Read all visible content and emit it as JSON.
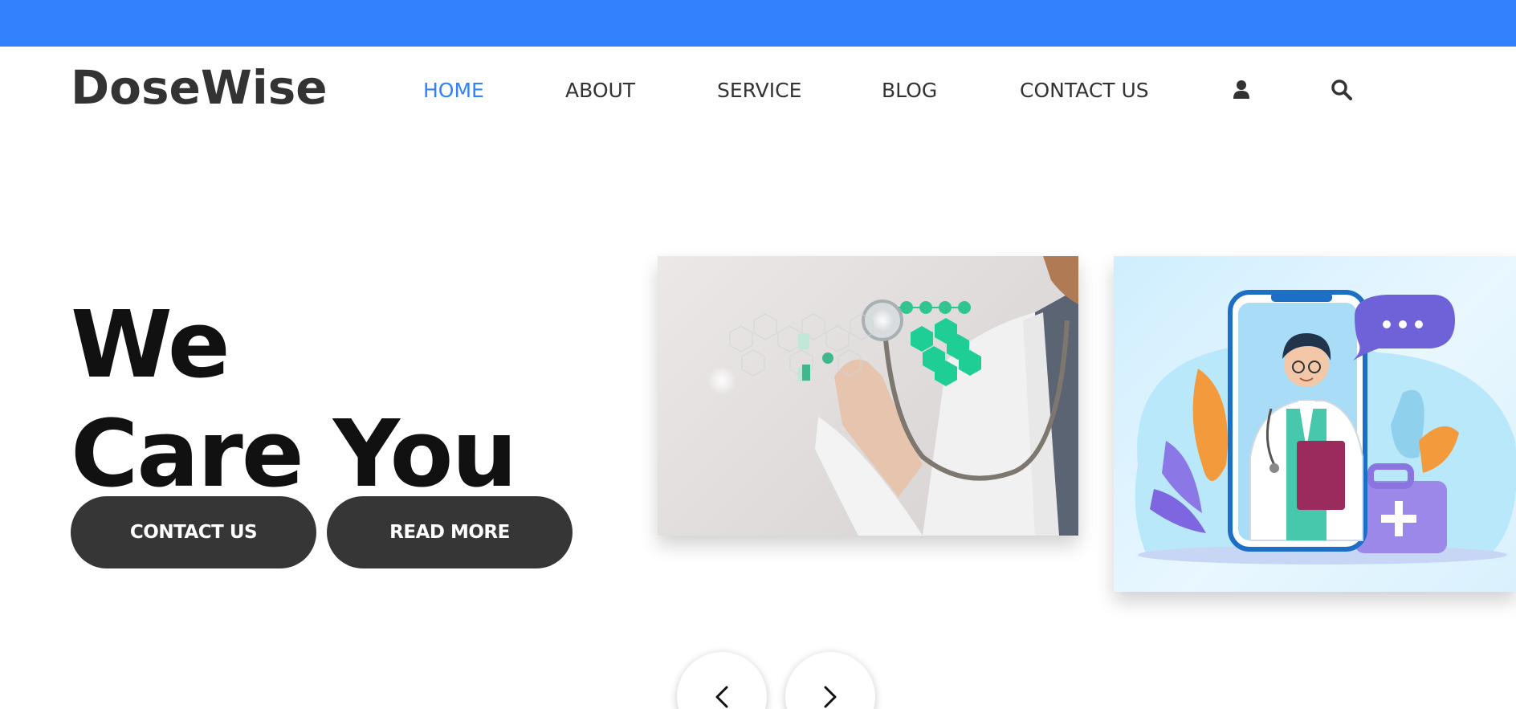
{
  "brand": {
    "name": "DoseWise",
    "accent_color": "#3282fd",
    "dark_button_color": "#363636"
  },
  "nav": {
    "items": [
      {
        "label": "HOME",
        "active": true
      },
      {
        "label": "ABOUT",
        "active": false
      },
      {
        "label": "SERVICE",
        "active": false
      },
      {
        "label": "BLOG",
        "active": false
      },
      {
        "label": "CONTACT US",
        "active": false
      }
    ],
    "icons": [
      "user-icon",
      "search-icon"
    ]
  },
  "hero": {
    "title_line1": "We",
    "title_line2": "Care You",
    "buttons": {
      "contact_label": "CONTACT US",
      "read_more_label": "READ MORE"
    }
  },
  "carousel": {
    "slides": [
      {
        "image": "doctor-stethoscope-medical-icons-photo"
      },
      {
        "image": "doctor-in-phone-telemedicine-illustration"
      }
    ],
    "controls": [
      "chevron-left-icon",
      "chevron-right-icon"
    ]
  }
}
